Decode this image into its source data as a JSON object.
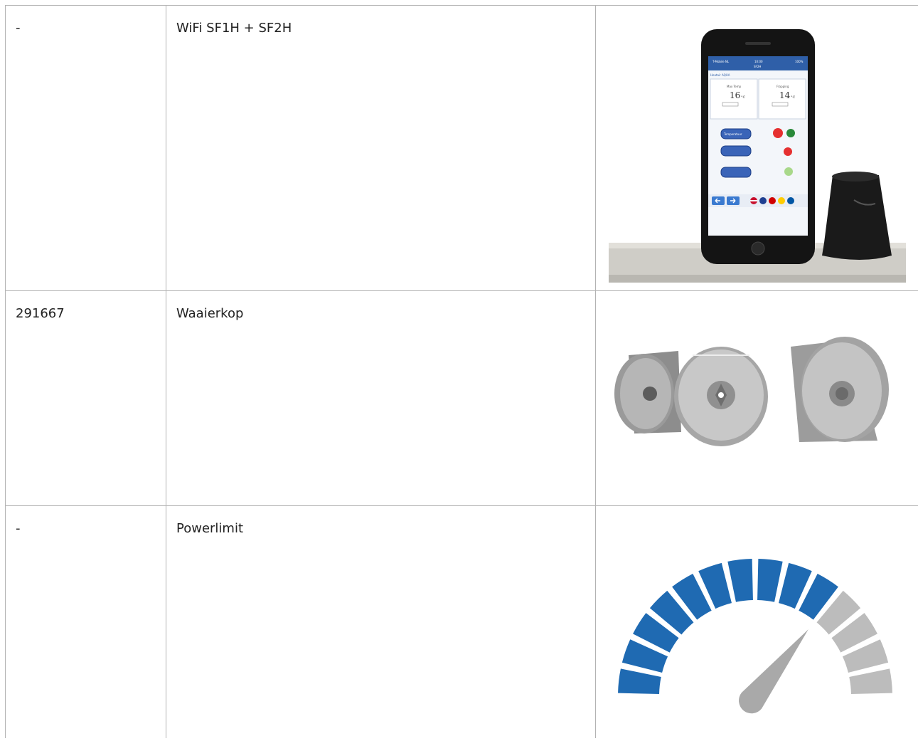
{
  "products": [
    {
      "code": "-",
      "name": "WiFi SF1H + SF2H",
      "image": {
        "icon": "smartphone-app-photo",
        "screen": {
          "status_left": "T-Mobile NL",
          "status_center": "10:00",
          "status_right": "100%",
          "header": "SF2H",
          "device": "Heatair AQUA",
          "temp_left_label": "Max Temp",
          "temp_left_value": "16",
          "temp_left_unit": "°C",
          "temp_right_label": "Frapping",
          "temp_right_value": "14",
          "temp_right_unit": "°C",
          "button_1": "Temperatuur"
        }
      }
    },
    {
      "code": "291667",
      "name": "Waaierkop",
      "image": {
        "icon": "fan-head-photo"
      }
    },
    {
      "code": "-",
      "name": "Powerlimit",
      "image": {
        "icon": "power-gauge-icon",
        "gauge": {
          "total_segments": 14,
          "active_segments": 10,
          "active_color": "#1f6ab2",
          "inactive_color": "#bcbcbc",
          "needle_color": "#a9a9a9"
        }
      }
    }
  ]
}
